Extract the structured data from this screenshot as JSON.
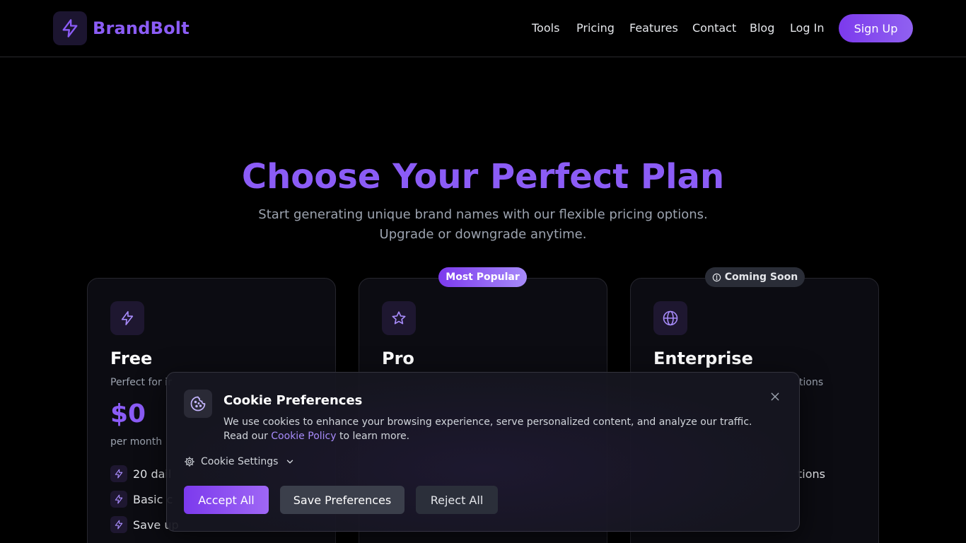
{
  "header": {
    "brand": "BrandBolt",
    "nav": [
      "Tools",
      "Pricing",
      "Features",
      "Contact",
      "Blog",
      "Log In"
    ],
    "signup": "Sign Up"
  },
  "hero": {
    "title": "Choose Your Perfect Plan",
    "subtitle": "Start generating unique brand names with our flexible pricing options. Upgrade or downgrade anytime."
  },
  "plans": [
    {
      "icon": "bolt-icon",
      "title": "Free",
      "desc": "Perfect for ir",
      "price": "$0",
      "period": "per month",
      "features": [
        "20 dail",
        "Basic c",
        "Save up"
      ]
    },
    {
      "icon": "star-icon",
      "title": "Pro",
      "badge": "Most Popular"
    },
    {
      "icon": "globe-icon",
      "title": "Enterprise",
      "desc": "tions",
      "feature_partial": "tions",
      "badge": "Coming Soon"
    }
  ],
  "cookie": {
    "icon": "cookie-icon",
    "title": "Cookie Preferences",
    "text_before": "We use cookies to enhance your browsing experience, serve personalized content, and analyze our traffic. Read our ",
    "link": "Cookie Policy",
    "text_after": " to learn more.",
    "settings_label": "Cookie Settings",
    "accept": "Accept All",
    "save": "Save Preferences",
    "reject": "Reject All"
  },
  "colors": {
    "accent": "#8b5cf6",
    "background": "#000000",
    "card": "#0c0c12"
  }
}
